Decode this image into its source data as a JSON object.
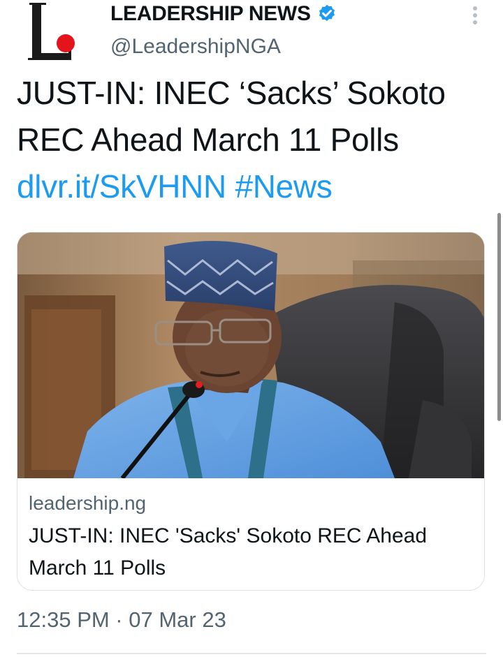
{
  "tweet": {
    "author": {
      "display_name": "LEADERSHIP NEWS",
      "handle": "@LeadershipNGA",
      "avatar_icon": "leadership-logo-icon",
      "verified_icon": "verified-badge-icon",
      "verified_color": "#1d9bf0"
    },
    "more_icon": "more-vertical-icon",
    "text": {
      "body": "JUST-IN: INEC ‘Sacks’ Sokoto REC Ahead March 11 Polls ",
      "link": "dlvr.it/SkVHNN",
      "hashtag": "#News",
      "link_color": "#1d9bf0"
    },
    "card": {
      "image_icon": "article-photo",
      "domain": "leadership.ng",
      "title": "JUST-IN: INEC 'Sacks' Sokoto REC Ahead March 11 Polls"
    },
    "timestamp": "12:35 PM · 07 Mar 23"
  }
}
